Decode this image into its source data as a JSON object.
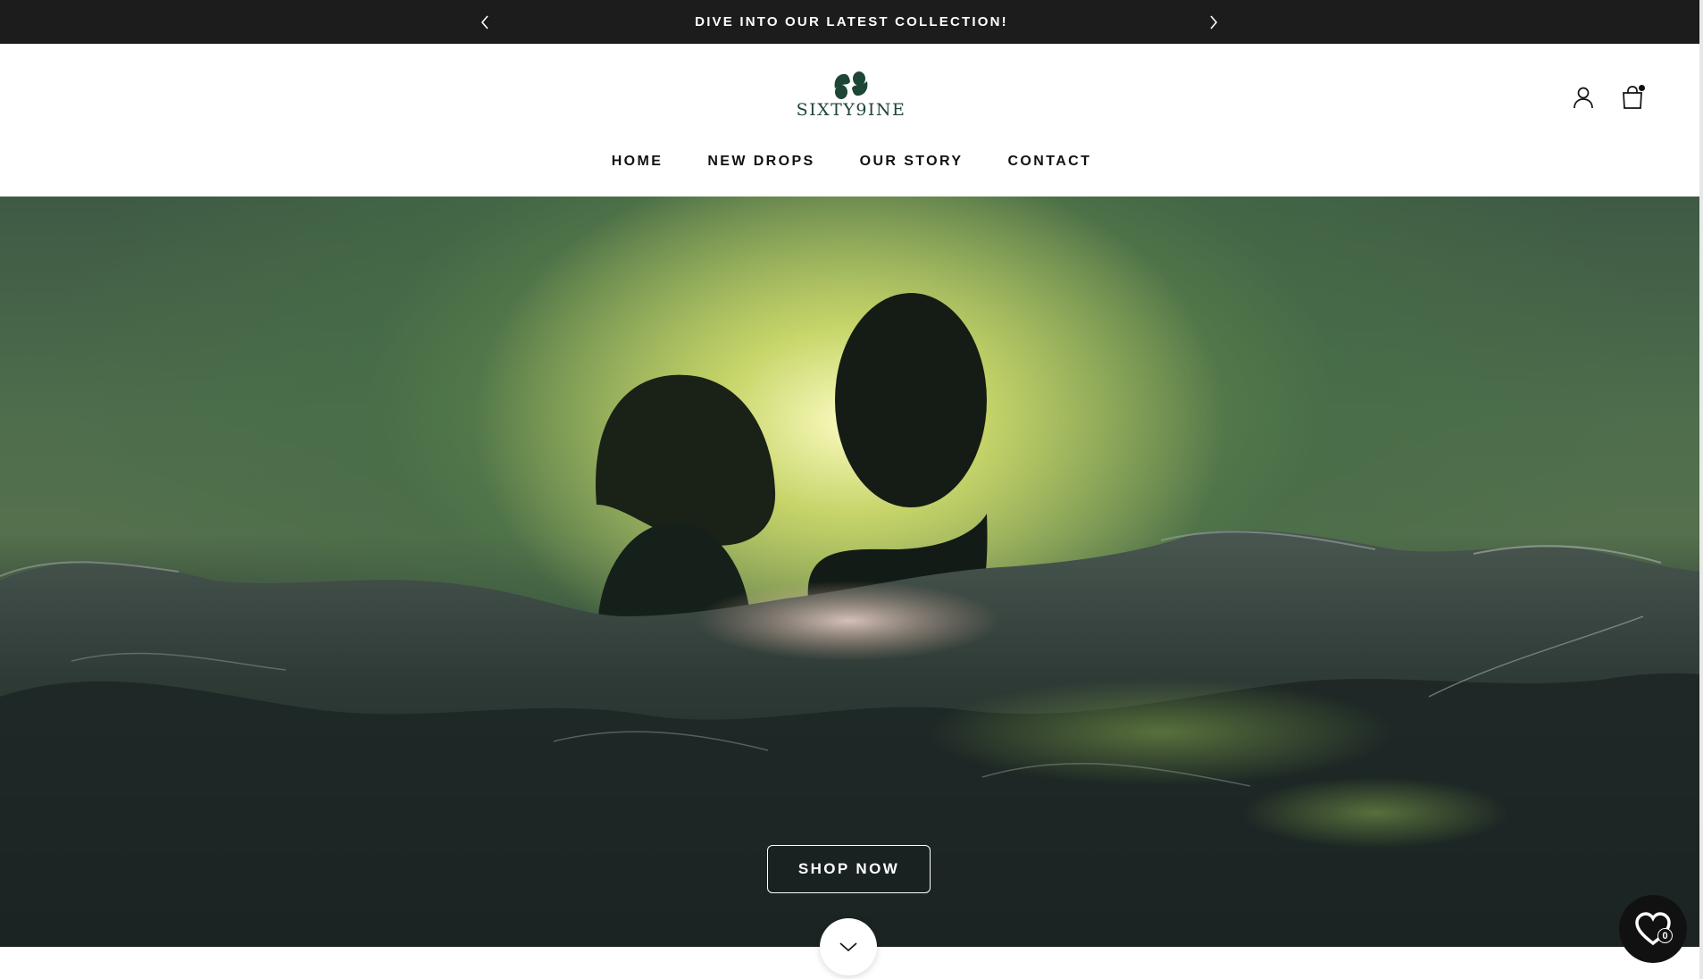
{
  "announcement": {
    "text": "DIVE INTO OUR LATEST COLLECTION!",
    "prev_icon": "chevron-left-icon",
    "next_icon": "chevron-right-icon"
  },
  "header": {
    "logo_text": "SIXTY9INE",
    "brand_color": "#1d4636",
    "icons": [
      "account-icon",
      "cart-icon"
    ],
    "cart_has_items": true
  },
  "nav": {
    "items": [
      {
        "label": "HOME"
      },
      {
        "label": "NEW DROPS"
      },
      {
        "label": "OUR STORY"
      },
      {
        "label": "CONTACT"
      }
    ]
  },
  "hero": {
    "cta_label": "SHOP NOW",
    "scroll_icon": "chevron-down-icon"
  },
  "wishlist": {
    "icon": "heart-icon",
    "count": "0"
  }
}
